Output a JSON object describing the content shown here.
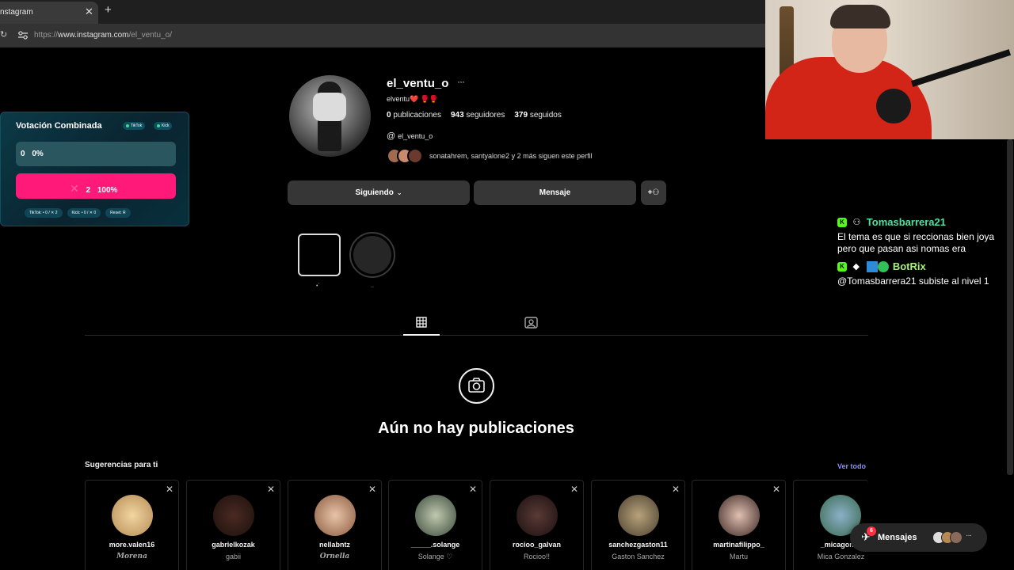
{
  "browser": {
    "tab_title": "nstagram",
    "url_prefix": "https://",
    "url_host": "www.instagram.com",
    "url_path": "/el_ventu_o/"
  },
  "profile": {
    "username": "el_ventu_o",
    "full_name": "elventu❤️ 🥊🥊",
    "posts_count": "0",
    "posts_label": "publicaciones",
    "followers_count": "943",
    "followers_label": "seguidores",
    "following_count": "379",
    "following_label": "seguidos",
    "threads_handle": "el_ventu_o",
    "followed_by_text": "sonatahrem, santyalone2 y 2 más siguen este perfil",
    "follow_button": "Siguiendo",
    "message_button": "Mensaje",
    "highlights": [
      {
        "label": "•´"
      },
      {
        "label": ".."
      }
    ],
    "empty_title": "Aún no hay publicaciones"
  },
  "suggestions": {
    "title": "Sugerencias para ti",
    "see_all": "Ver todo",
    "cards": [
      {
        "username": "more.valen16",
        "name": "Morena"
      },
      {
        "username": "gabrielkozak",
        "name": "gabii"
      },
      {
        "username": "nellabntz",
        "name": "Ornella"
      },
      {
        "username": "_____.solange",
        "name": "Solange ♡"
      },
      {
        "username": "rocioo_galvan",
        "name": "Rocioo!!"
      },
      {
        "username": "sanchezgaston11",
        "name": "Gaston Sanchez"
      },
      {
        "username": "martinafilippo_",
        "name": "Martu"
      },
      {
        "username": "_micagonza",
        "name": "Mica Gonzalez"
      }
    ]
  },
  "messages_pill": {
    "label": "Mensajes",
    "badge": "6"
  },
  "vote_overlay": {
    "title": "Votación Combinada",
    "chip_tiktok": "TikTok",
    "chip_kick": "Kick",
    "option1_count": "0",
    "option1_percent": "0%",
    "option2_count": "2",
    "option2_percent": "100%",
    "footer_tiktok": "TikTok: • 0 / ✕ 2",
    "footer_kick": "Kick: • 0 / ✕ 0",
    "footer_reset": "Reset: R"
  },
  "chat": {
    "messages": [
      {
        "user": "Tomasbarrera21",
        "text": "El tema es que si reccionas bien joya pero que pasan asi nomas era"
      },
      {
        "user": "BotRix",
        "text": "@Tomasbarrera21 subiste al nivel 1"
      }
    ]
  },
  "colors": {
    "accent_link": "#8c8cff",
    "vote_pink": "#ff1a7a",
    "kick_green": "#53fc18",
    "notification_red": "#ff3040"
  },
  "icons": [
    "reload-icon",
    "site-settings-icon",
    "threads-icon",
    "chevron-down-icon",
    "add-person-icon",
    "grid-icon",
    "tagged-icon",
    "camera-icon",
    "close-icon",
    "messages-icon",
    "kick-icon",
    "user-icon"
  ]
}
